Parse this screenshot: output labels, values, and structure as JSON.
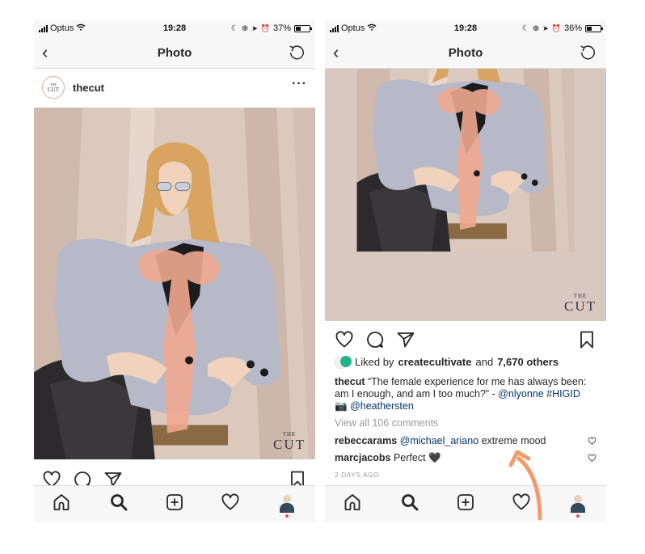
{
  "status_bar": {
    "left": {
      "carrier": "Optus",
      "time": "19:28",
      "battery": "37%",
      "battery_level": 0.37
    },
    "right": {
      "carrier": "Optus",
      "time": "19:28",
      "battery": "36%",
      "battery_level": 0.36
    }
  },
  "nav": {
    "title": "Photo"
  },
  "post": {
    "username": "thecut",
    "avatar_text_top": "THE",
    "avatar_text_bottom": "CUT",
    "watermark_the": "THE",
    "watermark_cut": "CUT"
  },
  "likes": {
    "prefix": "Liked by",
    "user": "createcultivate",
    "middle": "and",
    "others": "7,670 others"
  },
  "caption": {
    "username": "thecut",
    "text": "“The female experience for me has always been: am I enough, and am I too much?” - ",
    "mention1": "@nlyonne",
    "hashtag": "#HIGID",
    "emoji": "📷",
    "mention2": "@heathersten"
  },
  "view_comments": "View all 106 comments",
  "comments": [
    {
      "username": "rebeccarams",
      "mention": "@michael_ariano",
      "text": " extreme mood"
    },
    {
      "username": "marcjacobs",
      "text": "Perfect 🖤"
    }
  ],
  "post_time": "2 DAYS AGO",
  "colors": {
    "accent_arrow": "#f39a6a",
    "link": "#003569",
    "notification_dot": "#ed4956"
  },
  "icons": {
    "nav": [
      "chevron-left-icon",
      "refresh-icon"
    ],
    "actions": [
      "heart-icon",
      "comment-icon",
      "share-icon",
      "bookmark-icon"
    ],
    "tabs": [
      "home-icon",
      "search-icon",
      "add-icon",
      "activity-heart-icon",
      "profile-avatar"
    ]
  }
}
